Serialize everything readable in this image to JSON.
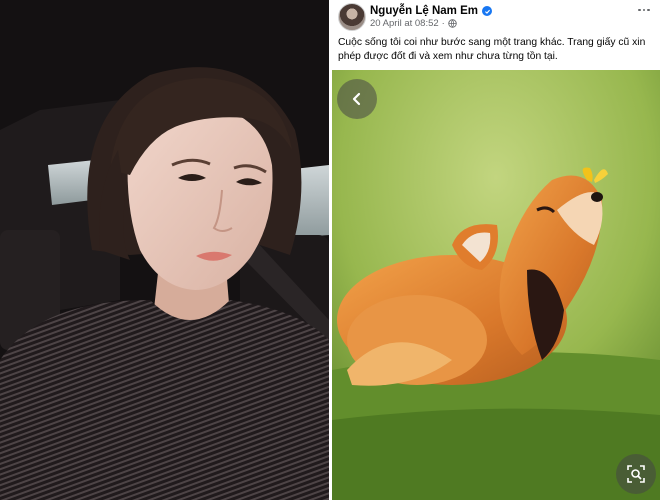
{
  "post": {
    "author_name": "Nguyễn Lệ Nam Em",
    "timestamp": "20 April at 08:52",
    "separator": "·",
    "caption": "Cuộc sống tôi coi như bước sang một trang khác. Trang giấy cũ xin phép được đốt đi và xem như chưa từng tồn tại.",
    "verified": true,
    "privacy_icon": "globe-icon"
  },
  "photo_viewer": {
    "back_icon": "chevron-left-icon",
    "zoom_icon": "zoom-search-icon"
  },
  "colors": {
    "verified_blue": "#1877f2",
    "text_primary": "#050505",
    "text_secondary": "#65676b",
    "overlay_button": "rgba(70,70,70,0.55)"
  }
}
